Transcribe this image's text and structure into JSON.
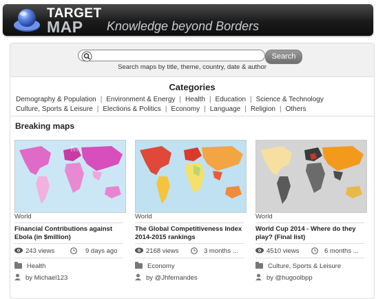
{
  "header": {
    "logo_top": "TARGET",
    "logo_bottom": "MAP",
    "tagline": "Knowledge beyond Borders"
  },
  "search": {
    "placeholder": "",
    "button_label": "Search",
    "hint": "Search maps by title, theme, country, date & author"
  },
  "categories": {
    "title": "Categories",
    "row1": [
      "Demography & Population",
      "Environment & Energy",
      "Health",
      "Education",
      "Science & Technology"
    ],
    "row2": [
      "Culture, Sports & Leisure",
      "Elections & Politics",
      "Economy",
      "Language",
      "Religion",
      "Others"
    ]
  },
  "breaking": {
    "title": "Breaking maps",
    "cards": [
      {
        "region": "World",
        "title": "Financial Contributions against Ebola (in $million)",
        "views": "243 views",
        "age": "9 days ago",
        "category": "Health",
        "author": "by Michael123"
      },
      {
        "region": "World",
        "title": "The Global Competitiveness Index 2014-2015 rankings",
        "views": "2168 views",
        "age": "3 months ...",
        "category": "Economy",
        "author": "by @Jhfernandes"
      },
      {
        "region": "World",
        "title": "World Cup 2014 - Where do they play? (Final list)",
        "views": "4510 views",
        "age": "6 months ...",
        "category": "Culture, Sports & Leisure",
        "author": "by @hugoolbpp"
      }
    ]
  },
  "colors": {
    "header_dark": "#1b1b1b",
    "search_button": "#7d7d7d",
    "map1_accent": "#d23fb0",
    "map2_accent": "#e0483a",
    "map3_accent": "#f39a1c"
  }
}
